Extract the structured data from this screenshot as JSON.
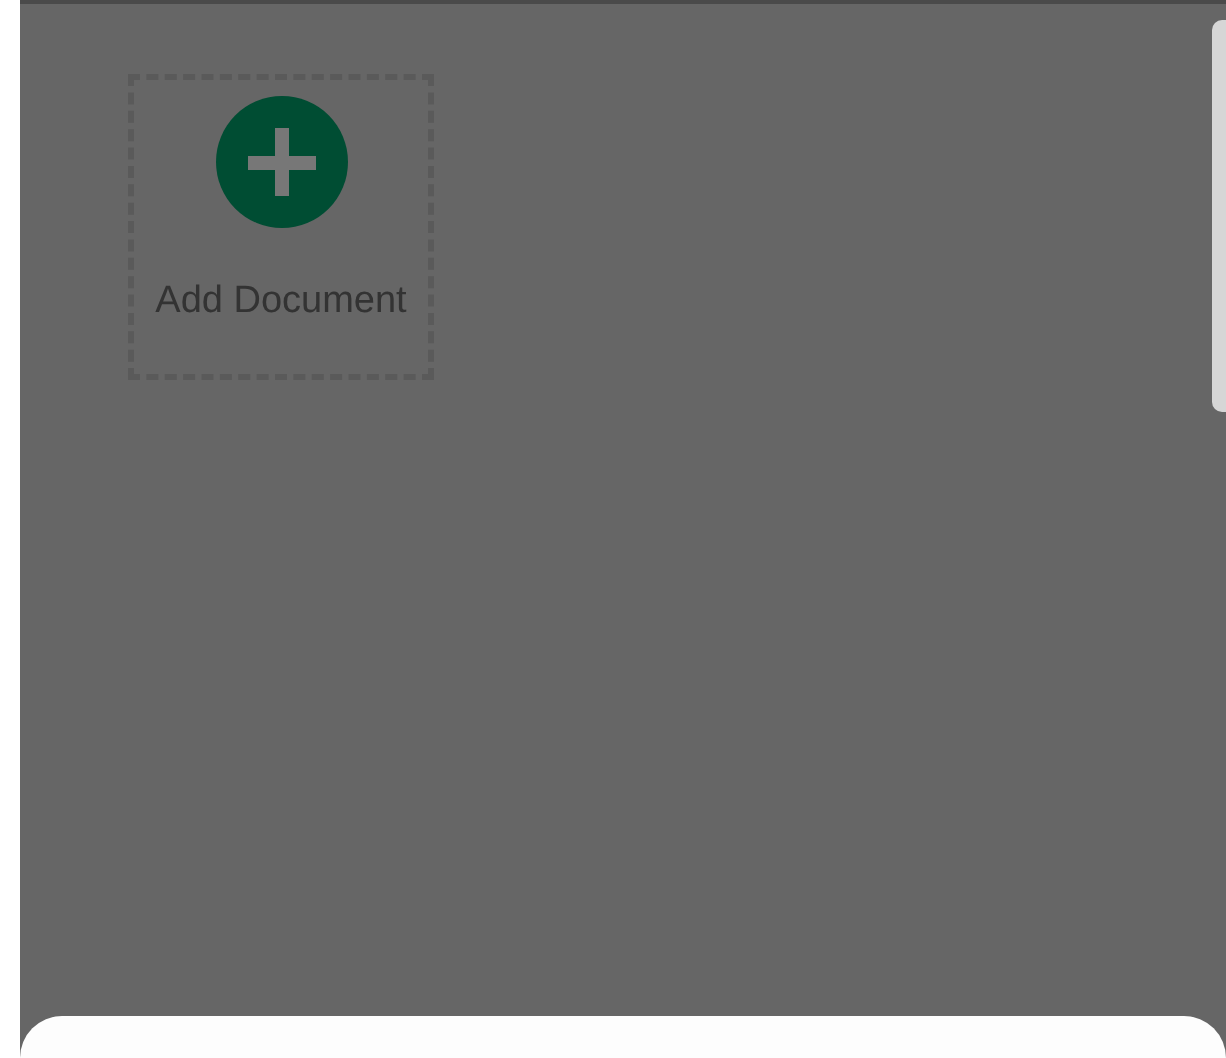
{
  "add_tile": {
    "label": "Add Document"
  }
}
